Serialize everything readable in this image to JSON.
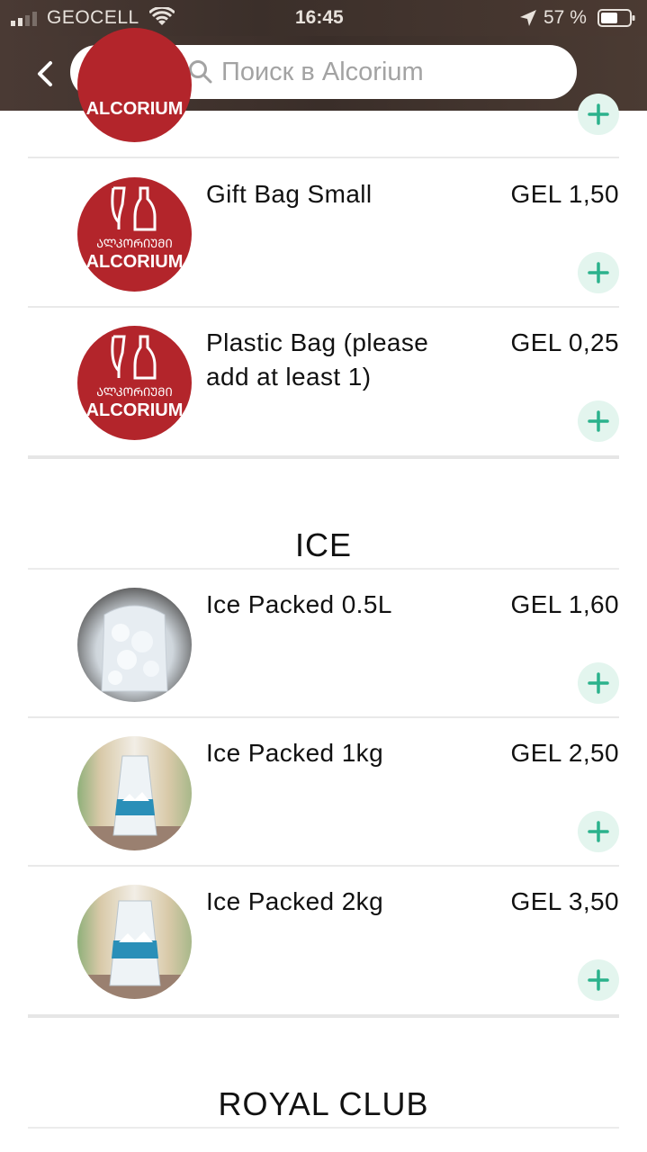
{
  "status_bar": {
    "carrier": "GEOCELL",
    "time": "16:45",
    "battery_percent": "57 %"
  },
  "search": {
    "placeholder": "Поиск в Alcorium"
  },
  "logo_text": "ALCORIUM",
  "sections": [
    {
      "title": "",
      "items": [
        {
          "name": "Gift Bag Small",
          "price": "GEL 1,50"
        },
        {
          "name": "Plastic Bag (please add at least 1)",
          "price": "GEL 0,25"
        }
      ]
    },
    {
      "title": "ICE",
      "items": [
        {
          "name": "Ice Packed 0.5L",
          "price": "GEL 1,60"
        },
        {
          "name": "Ice Packed 1kg",
          "price": "GEL 2,50"
        },
        {
          "name": "Ice Packed 2kg",
          "price": "GEL 3,50"
        }
      ]
    },
    {
      "title": "ROYAL CLUB",
      "items": []
    }
  ],
  "colors": {
    "brand_red": "#b3252b",
    "add_green": "#2bb28c",
    "header_bg": "#3b2f2a"
  }
}
